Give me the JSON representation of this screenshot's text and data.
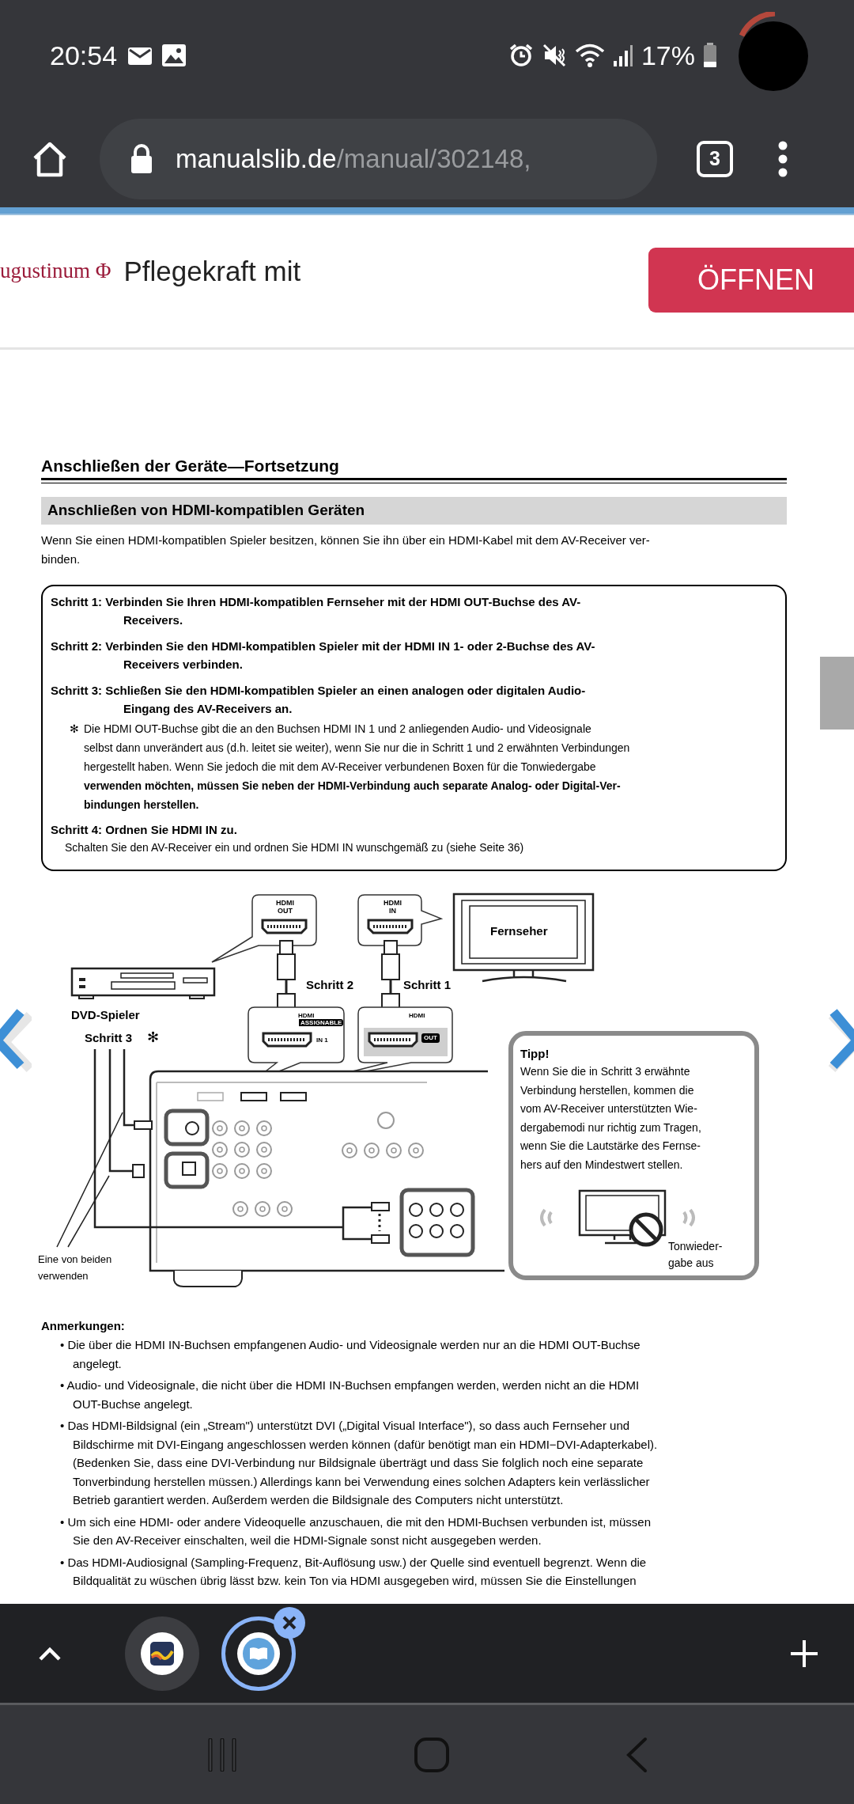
{
  "status_bar": {
    "time": "20:54",
    "battery": "17%"
  },
  "browser": {
    "url_host": "manualslib.de",
    "url_path": "/manual/302148,",
    "tab_count": "3"
  },
  "ad": {
    "brand": "ugustinum Φ",
    "text": "Pflegekraft mit",
    "button": "ÖFFNEN"
  },
  "document": {
    "heading": "Anschließen der Geräte—Fortsetzung",
    "section_title": "Anschließen von HDMI-kompatiblen Geräten",
    "intro": "Wenn Sie einen HDMI-kompatiblen Spieler besitzen, können Sie ihn über ein HDMI-Kabel mit dem AV-Receiver ver-\nbinden.",
    "steps": [
      {
        "kind": "step",
        "text": "Schritt 1: Verbinden Sie Ihren HDMI-kompatiblen Fernseher mit der HDMI OUT-Buchse des AV-\nReceivers."
      },
      {
        "kind": "step",
        "text": "Schritt 2: Verbinden Sie den HDMI-kompatiblen Spieler mit der HDMI IN 1- oder 2-Buchse des AV-\nReceivers verbinden."
      },
      {
        "kind": "step",
        "text": "Schritt 3: Schließen Sie den HDMI-kompatiblen Spieler an einen analogen oder digitalen Audio-\nEingang des AV-Receivers an."
      },
      {
        "kind": "note",
        "marker": "✻",
        "text": "Die HDMI OUT-Buchse gibt die an den Buchsen HDMI IN 1 und 2 anliegenden Audio- und Videosignale\nselbst dann unverändert aus (d.h. leitet sie weiter), wenn Sie nur die in Schritt 1 und 2 erwähnten Verbindungen\nhergestellt haben. Wenn Sie jedoch die mit dem AV-Receiver verbundenen Boxen für die Tonwiedergabe\n**verwenden möchten, müssen Sie neben der HDMI-Verbindung auch separate Analog- oder Digital-Ver-**\n**bindungen herstellen.**"
      },
      {
        "kind": "title",
        "text": "Schritt 4: Ordnen Sie HDMI IN zu."
      },
      {
        "kind": "detail",
        "text": "Schalten Sie den AV-Receiver ein und ordnen Sie HDMI IN wunschgemäß zu (siehe Seite 36)"
      }
    ]
  },
  "diagram": {
    "callout_out": "HDMI\nOUT",
    "callout_in": "HDMI\nIN",
    "tv": "Fernseher",
    "step_2": "Schritt 2",
    "step_1": "Schritt 1",
    "player": "DVD-Spieler",
    "step_3": "Schritt 3",
    "step_3_mark": "✻",
    "port_in_label": "HDMI",
    "port_in_badge": "ASSIGNABLE",
    "port_in_number": "IN 1",
    "port_out_label": "HDMI",
    "port_out_badge": "OUT",
    "use_either": "Eine von beiden\nverwenden",
    "tip": {
      "title": "Tipp!",
      "text": "Wenn Sie die in Schritt 3 erwähnte\nVerbindung herstellen, kommen die\nvom AV-Receiver unterstützten Wie-\ndergabemodi nur richtig zum Tragen,\nwenn Sie die Lautstärke des Fernse-\nhers auf den Mindestwert stellen.",
      "caption": "Tonwieder-\ngabe aus"
    }
  },
  "notes": {
    "title": "Anmerkungen:",
    "items": [
      "• Die über die HDMI IN-Buchsen empfangenen Audio- und Videosignale werden nur an die HDMI OUT-Buchse\nangelegt.",
      "• Audio- und Videosignale, die nicht über die HDMI IN-Buchsen empfangen werden, werden nicht an die HDMI\nOUT-Buchse angelegt.",
      "• Das HDMI-Bildsignal (ein „Stream\") unterstützt DVI („Digital Visual Interface\"), so dass auch Fernseher und\nBildschirme mit DVI-Eingang angeschlossen werden können (dafür benötigt man ein HDMI−DVI-Adapterkabel).\n(Bedenken Sie, dass eine DVI-Verbindung nur Bildsignale überträgt und dass Sie folglich noch eine separate\nTonverbindung herstellen müssen.) Allerdings kann bei Verwendung eines solchen Adapters kein verlässlicher\nBetrieb garantiert werden. Außerdem werden die Bildsignale des Computers nicht unterstützt.",
      "• Um sich eine HDMI- oder andere Videoquelle anzuschauen, die mit den HDMI-Buchsen verbunden ist, müssen\nSie den AV-Receiver einschalten, weil die HDMI-Signale sonst nicht ausgegeben werden.",
      "• Das HDMI-Audiosignal (Sampling-Frequenz, Bit-Auflösung usw.) der Quelle sind eventuell begrenzt. Wenn die\nBildqualität zu wüschen übrig lässt bzw. kein Ton via HDMI ausgegeben wird, müssen Sie die Einstellungen"
    ]
  },
  "tab_strip": {
    "tabs": [
      {
        "selected": false
      },
      {
        "selected": true
      }
    ]
  }
}
